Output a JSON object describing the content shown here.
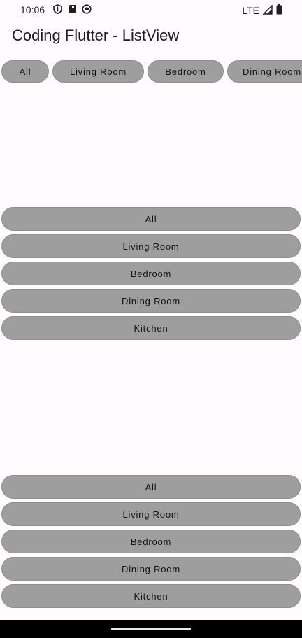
{
  "status_bar": {
    "time": "10:06",
    "network": "LTE",
    "icons_left": [
      "shield-icon",
      "sd-card-icon",
      "app-notification-icon"
    ],
    "icons_right": [
      "signal-icon",
      "battery-icon"
    ]
  },
  "app_bar": {
    "title": "Coding Flutter - ListView"
  },
  "horizontal_list": {
    "items": [
      "All",
      "Living Room",
      "Bedroom",
      "Dining Room"
    ]
  },
  "vertical_list_1": {
    "items": [
      "All",
      "Living Room",
      "Bedroom",
      "Dining Room",
      "Kitchen"
    ]
  },
  "vertical_list_2": {
    "items": [
      "All",
      "Living Room",
      "Bedroom",
      "Dining Room",
      "Kitchen"
    ]
  },
  "colors": {
    "background": "#fffbfe",
    "button_fill": "#9e9e9e",
    "nav_bar": "#000000"
  }
}
